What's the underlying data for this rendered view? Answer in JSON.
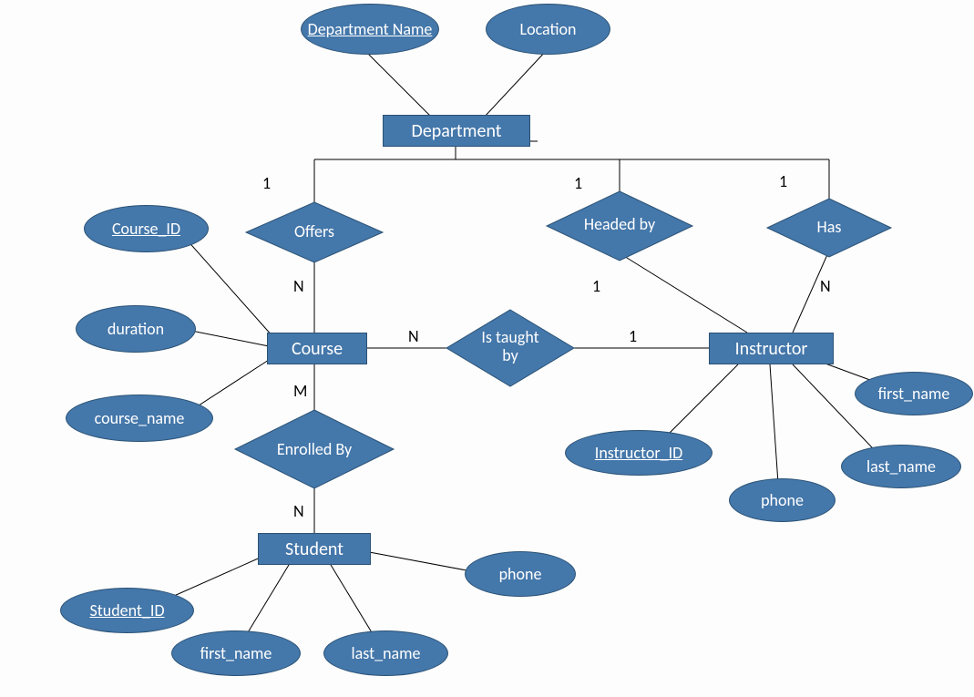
{
  "entities": {
    "department": "Department",
    "course": "Course",
    "instructor": "Instructor",
    "student": "Student"
  },
  "attributes": {
    "dept_name": "Department Name",
    "location": "Location",
    "course_id": "Course_ID",
    "duration": "duration",
    "course_name": "course_name",
    "instructor_id": "Instructor_ID",
    "first_name": "first_name",
    "last_name": "last_name",
    "phone": "phone",
    "student_id": "Student_ID",
    "s_first_name": "first_name",
    "s_last_name": "last_name",
    "s_phone": "phone"
  },
  "relationships": {
    "offers": "Offers",
    "headed_by": "Headed by",
    "has": "Has",
    "taught_by": "Is taught by",
    "enrolled_by": "Enrolled By"
  },
  "cardinalities": {
    "dept_offers": "1",
    "offers_course": "N",
    "dept_headed": "1",
    "headed_instructor": "1",
    "dept_has": "1",
    "has_instructor": "N",
    "course_enrolled": "M",
    "enrolled_student": "N",
    "course_taught": "N",
    "taught_instructor": "1"
  }
}
